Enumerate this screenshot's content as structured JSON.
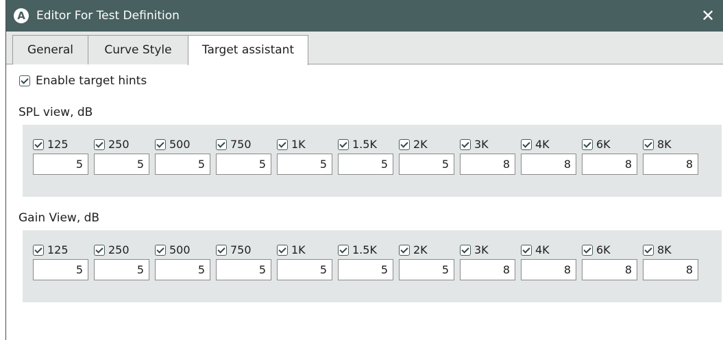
{
  "window": {
    "app_icon_letter": "A",
    "title": "Editor For Test Definition",
    "close_glyph": "✕"
  },
  "tabs": [
    {
      "label": "General",
      "active": false
    },
    {
      "label": "Curve Style",
      "active": false
    },
    {
      "label": "Target assistant",
      "active": true
    }
  ],
  "enable_hints": {
    "label": "Enable target hints",
    "checked": true
  },
  "spl_section": {
    "label": "SPL view, dB",
    "bands": [
      {
        "label": "125",
        "checked": true,
        "value": "5"
      },
      {
        "label": "250",
        "checked": true,
        "value": "5"
      },
      {
        "label": "500",
        "checked": true,
        "value": "5"
      },
      {
        "label": "750",
        "checked": true,
        "value": "5"
      },
      {
        "label": "1K",
        "checked": true,
        "value": "5"
      },
      {
        "label": "1.5K",
        "checked": true,
        "value": "5"
      },
      {
        "label": "2K",
        "checked": true,
        "value": "5"
      },
      {
        "label": "3K",
        "checked": true,
        "value": "8"
      },
      {
        "label": "4K",
        "checked": true,
        "value": "8"
      },
      {
        "label": "6K",
        "checked": true,
        "value": "8"
      },
      {
        "label": "8K",
        "checked": true,
        "value": "8"
      }
    ]
  },
  "gain_section": {
    "label": "Gain View, dB",
    "bands": [
      {
        "label": "125",
        "checked": true,
        "value": "5"
      },
      {
        "label": "250",
        "checked": true,
        "value": "5"
      },
      {
        "label": "500",
        "checked": true,
        "value": "5"
      },
      {
        "label": "750",
        "checked": true,
        "value": "5"
      },
      {
        "label": "1K",
        "checked": true,
        "value": "5"
      },
      {
        "label": "1.5K",
        "checked": true,
        "value": "5"
      },
      {
        "label": "2K",
        "checked": true,
        "value": "5"
      },
      {
        "label": "3K",
        "checked": true,
        "value": "8"
      },
      {
        "label": "4K",
        "checked": true,
        "value": "8"
      },
      {
        "label": "6K",
        "checked": true,
        "value": "8"
      },
      {
        "label": "8K",
        "checked": true,
        "value": "8"
      }
    ]
  },
  "colors": {
    "titlebar": "#486060",
    "tabstrip": "#e6e8e8",
    "panel": "#e3e6e6",
    "checkbox_border": "#4a5c5c"
  }
}
